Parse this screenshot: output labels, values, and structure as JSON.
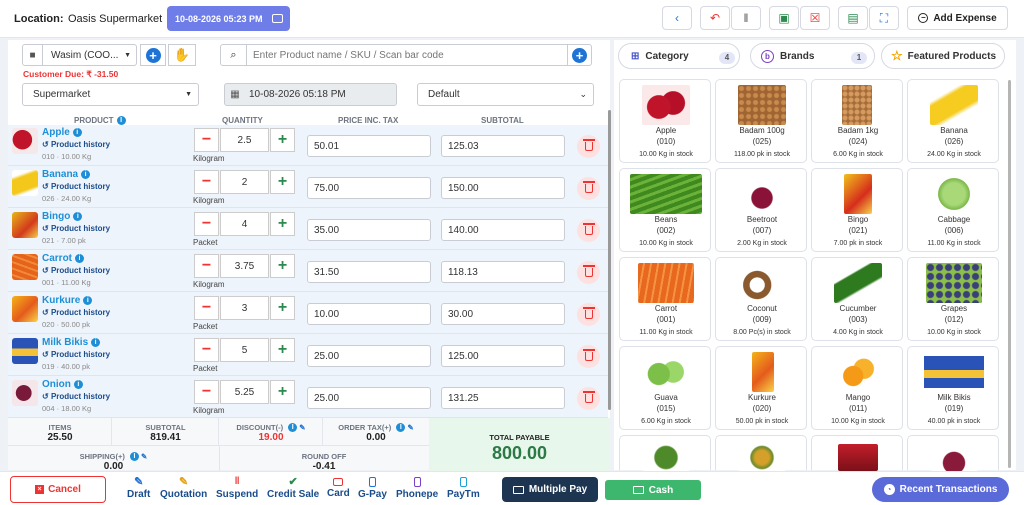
{
  "header": {
    "location_label": "Location:",
    "location_value": "Oasis Supermarket",
    "datetime": "10-08-2026 05:23 PM",
    "add_expense": "Add Expense"
  },
  "customer": {
    "name": "Wasim (COO...",
    "due_label": "Customer Due:",
    "due_value": "₹ -31.50"
  },
  "search": {
    "placeholder": "Enter Product name / SKU / Scan bar code"
  },
  "controls": {
    "store": "Supermarket",
    "datetime": "10-08-2026 05:18 PM",
    "price_group": "Default"
  },
  "table": {
    "headers": {
      "product": "PRODUCT",
      "quantity": "QUANTITY",
      "price": "PRICE INC. TAX",
      "subtotal": "SUBTOTAL"
    },
    "history_label": "Product history",
    "rows": [
      {
        "name": "Apple",
        "meta": "010 · 10.00 Kg",
        "qty": "2.5",
        "unit": "Kilogram",
        "price": "50.01",
        "subtotal": "125.03"
      },
      {
        "name": "Banana",
        "meta": "026 · 24.00 Kg",
        "qty": "2",
        "unit": "Kilogram",
        "price": "75.00",
        "subtotal": "150.00"
      },
      {
        "name": "Bingo",
        "meta": "021 · 7.00 pk",
        "qty": "4",
        "unit": "Packet",
        "price": "35.00",
        "subtotal": "140.00"
      },
      {
        "name": "Carrot",
        "meta": "001 · 11.00 Kg",
        "qty": "3.75",
        "unit": "Kilogram",
        "price": "31.50",
        "subtotal": "118.13"
      },
      {
        "name": "Kurkure",
        "meta": "020 · 50.00 pk",
        "qty": "3",
        "unit": "Packet",
        "price": "10.00",
        "subtotal": "30.00"
      },
      {
        "name": "Milk Bikis",
        "meta": "019 · 40.00 pk",
        "qty": "5",
        "unit": "Packet",
        "price": "25.00",
        "subtotal": "125.00"
      },
      {
        "name": "Onion",
        "meta": "004 · 18.00 Kg",
        "qty": "5.25",
        "unit": "Kilogram",
        "price": "25.00",
        "subtotal": "131.25"
      }
    ]
  },
  "totals": {
    "items_label": "ITEMS",
    "items": "25.50",
    "subtotal_label": "SUBTOTAL",
    "subtotal": "819.41",
    "discount_label": "DISCOUNT(-)",
    "discount": "19.00",
    "ordertax_label": "ORDER TAX(+)",
    "ordertax": "0.00",
    "shipping_label": "SHIPPING(+)",
    "shipping": "0.00",
    "roundoff_label": "ROUND OFF",
    "roundoff": "-0.41",
    "payable_label": "TOTAL PAYABLE",
    "payable": "800.00"
  },
  "filters": {
    "category": "Category",
    "category_count": "4",
    "brands": "Brands",
    "brands_count": "1",
    "featured": "Featured Products"
  },
  "products": [
    {
      "name": "Apple",
      "code": "(010)",
      "stock": "10.00 Kg in stock"
    },
    {
      "name": "Badam 100g",
      "code": "(025)",
      "stock": "118.00 pk in stock"
    },
    {
      "name": "Badam 1kg",
      "code": "(024)",
      "stock": "6.00 Kg in stock"
    },
    {
      "name": "Banana",
      "code": "(026)",
      "stock": "24.00 Kg in stock"
    },
    {
      "name": "Beans",
      "code": "(002)",
      "stock": "10.00 Kg in stock"
    },
    {
      "name": "Beetroot",
      "code": "(007)",
      "stock": "2.00 Kg in stock"
    },
    {
      "name": "Bingo",
      "code": "(021)",
      "stock": "7.00 pk in stock"
    },
    {
      "name": "Cabbage",
      "code": "(006)",
      "stock": "11.00 Kg in stock"
    },
    {
      "name": "Carrot",
      "code": "(001)",
      "stock": "11.00 Kg in stock"
    },
    {
      "name": "Coconut",
      "code": "(009)",
      "stock": "8.00 Pc(s) in stock"
    },
    {
      "name": "Cucumber",
      "code": "(003)",
      "stock": "4.00 Kg in stock"
    },
    {
      "name": "Grapes",
      "code": "(012)",
      "stock": "10.00 Kg in stock"
    },
    {
      "name": "Guava",
      "code": "(015)",
      "stock": "6.00 Kg in stock"
    },
    {
      "name": "Kurkure",
      "code": "(020)",
      "stock": "50.00 pk in stock"
    },
    {
      "name": "Mango",
      "code": "(011)",
      "stock": "10.00 Kg in stock"
    },
    {
      "name": "Milk Bikis",
      "code": "(019)",
      "stock": "40.00 pk in stock"
    }
  ],
  "footer": {
    "cancel": "Cancel",
    "draft": "Draft",
    "quotation": "Quotation",
    "suspend": "Suspend",
    "credit_sale": "Credit Sale",
    "card": "Card",
    "gpay": "G-Pay",
    "phonepe": "Phonepe",
    "paytm": "PayTm",
    "multiple_pay": "Multiple Pay",
    "cash": "Cash",
    "recent": "Recent Transactions"
  }
}
